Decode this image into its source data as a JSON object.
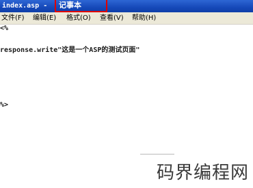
{
  "window": {
    "file_title": "index.asp -",
    "app_name": "记事本"
  },
  "menu": [
    {
      "label": "文件(F)"
    },
    {
      "label": "编辑(E)"
    },
    {
      "label": "格式(O)"
    },
    {
      "label": "查看(V)"
    },
    {
      "label": "帮助(H)"
    }
  ],
  "editor": {
    "lines": [
      "<%",
      "response.write\"这是一个ASP的测试页面\"",
      "%>"
    ]
  },
  "watermark": "码界编程网",
  "colors": {
    "titlebar": "#1649b9",
    "highlight": "#e00000",
    "menubar": "#ece9d8"
  }
}
